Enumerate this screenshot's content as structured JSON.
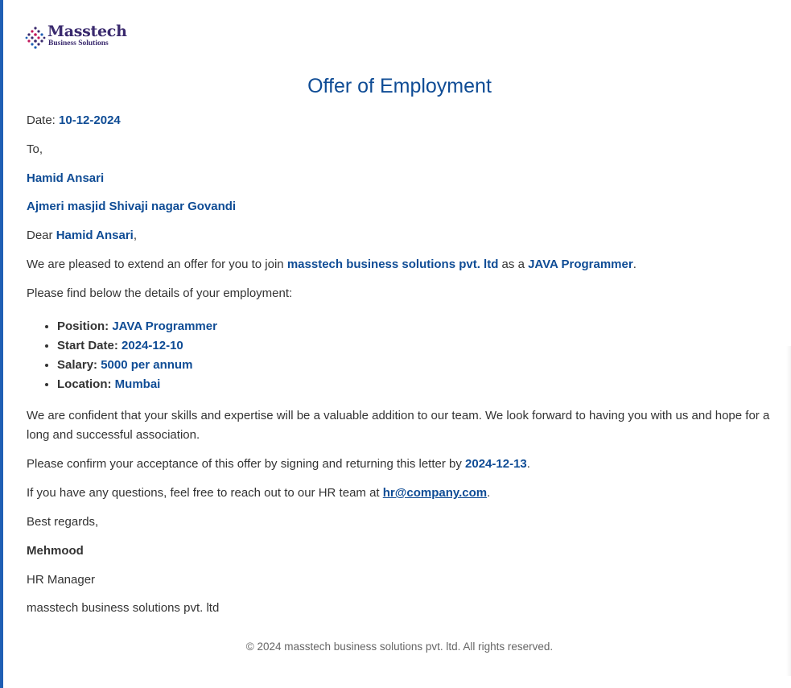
{
  "logo": {
    "name": "Masstech",
    "subtitle": "Business Solutions",
    "dot_colors": [
      "#3a2a6e",
      "#c2185b",
      "#1f5fb4"
    ]
  },
  "colors": {
    "accent": "#0f4c95",
    "text": "#333333",
    "left_rule": "#1f5fb4"
  },
  "title": "Offer of Employment",
  "date": {
    "label": "Date: ",
    "value": "10-12-2024"
  },
  "to_label": "To,",
  "recipient": {
    "name": "Hamid Ansari",
    "address": "Ajmeri masjid Shivaji nagar Govandi"
  },
  "salutation": {
    "prefix": "Dear ",
    "name": "Hamid Ansari",
    "suffix": ","
  },
  "intro": {
    "text1": "We are pleased to extend an offer for you to join ",
    "company": "masstech business solutions pvt. ltd",
    "text2": " as a ",
    "position": "JAVA Programmer",
    "text3": "."
  },
  "details_intro": "Please find below the details of your employment:",
  "details": [
    {
      "label": "Position: ",
      "value": "JAVA Programmer"
    },
    {
      "label": "Start Date: ",
      "value": "2024-12-10"
    },
    {
      "label": "Salary: ",
      "value": "5000 per annum"
    },
    {
      "label": "Location: ",
      "value": "Mumbai"
    }
  ],
  "confidence_text": "We are confident that your skills and expertise will be a valuable addition to our team. We look forward to having you with us and hope for a long and successful association.",
  "confirm": {
    "text1": "Please confirm your acceptance of this offer by signing and returning this letter by ",
    "deadline": "2024-12-13",
    "text2": "."
  },
  "questions": {
    "text1": "If you have any questions, feel free to reach out to our HR team at ",
    "email": "hr@company.com",
    "text2": "."
  },
  "closing": "Best regards,",
  "signer": {
    "name": "Mehmood",
    "role": "HR Manager",
    "company": "masstech business solutions pvt. ltd"
  },
  "footer": "© 2024 masstech business solutions pvt. ltd. All rights reserved."
}
